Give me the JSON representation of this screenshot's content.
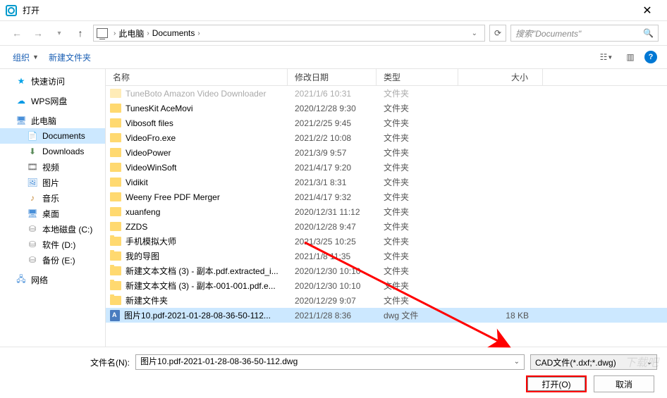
{
  "title": "打开",
  "breadcrumb": {
    "pc": "此电脑",
    "folder": "Documents"
  },
  "search_placeholder": "搜索\"Documents\"",
  "toolbar": {
    "organize": "组织",
    "new_folder": "新建文件夹"
  },
  "sidebar": {
    "quick": "快速访问",
    "wps": "WPS网盘",
    "pc": "此电脑",
    "documents": "Documents",
    "downloads": "Downloads",
    "video": "视频",
    "pictures": "图片",
    "music": "音乐",
    "desktop": "桌面",
    "disk_c": "本地磁盘 (C:)",
    "disk_d": "软件 (D:)",
    "disk_e": "备份 (E:)",
    "network": "网络"
  },
  "columns": {
    "name": "名称",
    "date": "修改日期",
    "type": "类型",
    "size": "大小"
  },
  "rows": [
    {
      "name": "TuneBoto Amazon Video Downloader",
      "date": "2021/1/6 10:31",
      "type": "文件夹",
      "size": "",
      "cut": true
    },
    {
      "name": "TunesKit AceMovi",
      "date": "2020/12/28 9:30",
      "type": "文件夹",
      "size": ""
    },
    {
      "name": "Vibosoft files",
      "date": "2021/2/25 9:45",
      "type": "文件夹",
      "size": ""
    },
    {
      "name": "VideoFro.exe",
      "date": "2021/2/2 10:08",
      "type": "文件夹",
      "size": ""
    },
    {
      "name": "VideoPower",
      "date": "2021/3/9 9:57",
      "type": "文件夹",
      "size": ""
    },
    {
      "name": "VideoWinSoft",
      "date": "2021/4/17 9:20",
      "type": "文件夹",
      "size": ""
    },
    {
      "name": "Vidikit",
      "date": "2021/3/1 8:31",
      "type": "文件夹",
      "size": ""
    },
    {
      "name": "Weeny Free PDF Merger",
      "date": "2021/4/17 9:32",
      "type": "文件夹",
      "size": ""
    },
    {
      "name": "xuanfeng",
      "date": "2020/12/31 11:12",
      "type": "文件夹",
      "size": ""
    },
    {
      "name": "ZZDS",
      "date": "2020/12/28 9:47",
      "type": "文件夹",
      "size": ""
    },
    {
      "name": "手机模拟大师",
      "date": "2021/3/25 10:25",
      "type": "文件夹",
      "size": ""
    },
    {
      "name": "我的导图",
      "date": "2021/1/8 11:35",
      "type": "文件夹",
      "size": ""
    },
    {
      "name": "新建文本文档 (3) - 副本.pdf.extracted_i...",
      "date": "2020/12/30 10:10",
      "type": "文件夹",
      "size": ""
    },
    {
      "name": "新建文本文档 (3) - 副本-001-001.pdf.e...",
      "date": "2020/12/30 10:10",
      "type": "文件夹",
      "size": ""
    },
    {
      "name": "新建文件夹",
      "date": "2020/12/29 9:07",
      "type": "文件夹",
      "size": ""
    },
    {
      "name": "图片10.pdf-2021-01-28-08-36-50-112...",
      "date": "2021/1/28 8:36",
      "type": "dwg 文件",
      "size": "18 KB",
      "selected": true,
      "file": true
    }
  ],
  "filename_label": "文件名(N):",
  "filename_value": "图片10.pdf-2021-01-28-08-36-50-112.dwg",
  "filter_value": "CAD文件(*.dxf;*.dwg)",
  "buttons": {
    "open": "打开(O)",
    "cancel": "取消"
  },
  "watermark": "下载吧"
}
